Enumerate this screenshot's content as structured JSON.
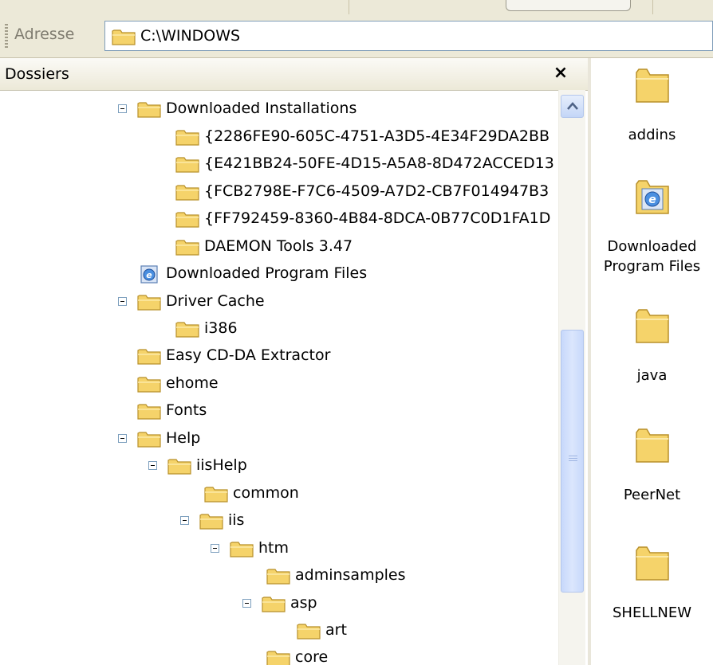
{
  "address_bar": {
    "label": "Adresse",
    "value": "C:\\WINDOWS"
  },
  "folders_pane": {
    "title": "Dossiers",
    "close_glyph": "×"
  },
  "tree": [
    {
      "label": "Downloaded Installations",
      "expanded": true,
      "icon": "folder-icon"
    },
    {
      "label": "{2286FE90-605C-4751-A3D5-4E34F29DA2BB",
      "icon": "folder-icon"
    },
    {
      "label": "{E421BB24-50FE-4D15-A5A8-8D472ACCED13",
      "icon": "folder-icon"
    },
    {
      "label": "{FCB2798E-F7C6-4509-A7D2-CB7F014947B3",
      "icon": "folder-icon"
    },
    {
      "label": "{FF792459-8360-4B84-8DCA-0B77C0D1FA1D",
      "icon": "folder-icon"
    },
    {
      "label": "DAEMON Tools 3.47",
      "icon": "folder-icon"
    },
    {
      "label": "Downloaded Program Files",
      "icon": "ie-folder-icon"
    },
    {
      "label": "Driver Cache",
      "expanded": true,
      "icon": "folder-icon"
    },
    {
      "label": "i386",
      "icon": "folder-icon"
    },
    {
      "label": "Easy CD-DA Extractor",
      "icon": "folder-icon"
    },
    {
      "label": "ehome",
      "icon": "folder-icon"
    },
    {
      "label": "Fonts",
      "icon": "folder-icon"
    },
    {
      "label": "Help",
      "expanded": true,
      "icon": "folder-icon"
    },
    {
      "label": "iisHelp",
      "expanded": true,
      "icon": "folder-icon"
    },
    {
      "label": "common",
      "icon": "folder-icon"
    },
    {
      "label": "iis",
      "expanded": true,
      "icon": "folder-icon"
    },
    {
      "label": "htm",
      "expanded": true,
      "icon": "folder-icon"
    },
    {
      "label": "adminsamples",
      "icon": "folder-icon"
    },
    {
      "label": "asp",
      "expanded": true,
      "icon": "folder-icon"
    },
    {
      "label": "art",
      "icon": "folder-icon"
    },
    {
      "label": "core",
      "icon": "folder-icon"
    }
  ],
  "icon_pane": [
    {
      "label": "addins",
      "icon": "folder-icon"
    },
    {
      "label": "Downloaded Program Files",
      "icon": "ie-folder-icon"
    },
    {
      "label": "java",
      "icon": "folder-icon"
    },
    {
      "label": "PeerNet",
      "icon": "folder-icon"
    },
    {
      "label": "SHELLNEW",
      "icon": "folder-icon"
    }
  ],
  "colors": {
    "folder_fill": "#f5d36a",
    "folder_edge": "#b8902a",
    "toolbar_bg": "#ece9d8",
    "scroll_accent": "#c4d6f7"
  }
}
